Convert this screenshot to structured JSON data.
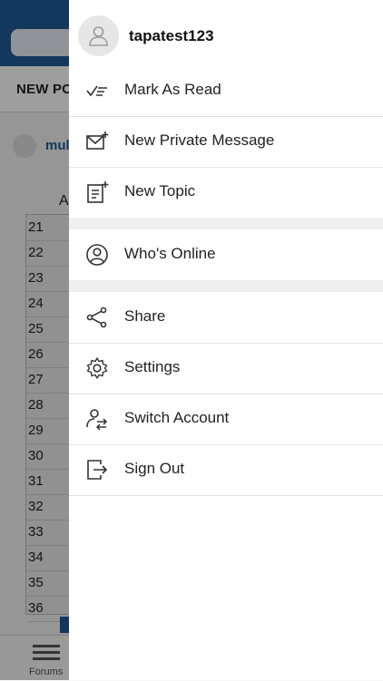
{
  "background": {
    "tab_label": "NEW PO",
    "user_fragment": "mul",
    "column_letter": "A",
    "row_numbers": [
      "21",
      "22",
      "23",
      "24",
      "25",
      "26",
      "27",
      "28",
      "29",
      "30",
      "31",
      "32",
      "33",
      "34",
      "35",
      "36"
    ],
    "tabbar_label": "Forums"
  },
  "drawer": {
    "username": "tapatest123",
    "items": [
      {
        "label": "Mark As Read",
        "icon": "mark-read-icon"
      },
      {
        "label": "New Private Message",
        "icon": "envelope-plus-icon"
      },
      {
        "label": "New Topic",
        "icon": "new-topic-icon"
      },
      {
        "label": "Who's Online",
        "icon": "user-circle-icon"
      },
      {
        "label": "Share",
        "icon": "share-icon"
      },
      {
        "label": "Settings",
        "icon": "gear-icon"
      },
      {
        "label": "Switch Account",
        "icon": "switch-account-icon"
      },
      {
        "label": "Sign Out",
        "icon": "sign-out-icon"
      }
    ]
  },
  "colors": {
    "header_blue": "#1f5a96",
    "overlay": "rgba(0,0,0,0.38)",
    "separator": "#efefef"
  }
}
